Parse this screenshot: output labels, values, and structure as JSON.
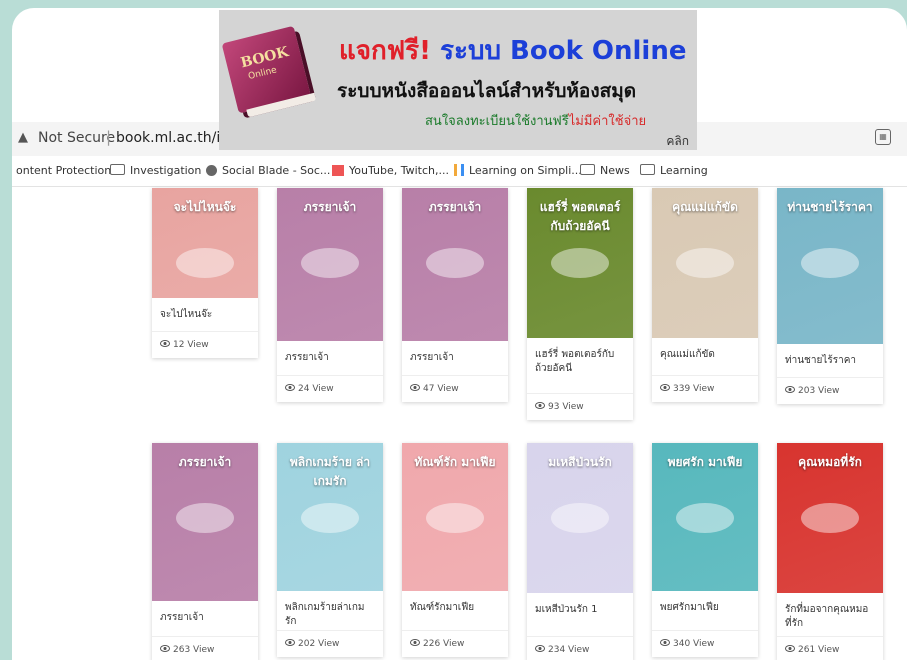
{
  "banner": {
    "line1_red": "แจกฟรี!",
    "line1_blue": "ระบบ Book Online",
    "line2": "ระบบหนังสือออนไลน์สำหรับห้องสมุด",
    "line3_green": "สนใจลงทะเบียนใช้งานฟรี",
    "line3_red": "ไม่มีค่าใช้จ่าย",
    "click": "คลิก",
    "book_title": "BOOK",
    "book_subtitle": "Online"
  },
  "browser": {
    "warning": "Not Secure",
    "url": "book.ml.ac.th/index"
  },
  "bookmarks": [
    "ontent Protection",
    "Investigation",
    "Social Blade - Soc...",
    "YouTube, Twitch,...",
    "Learning on Simpli...",
    "News",
    "Learning"
  ],
  "books": [
    {
      "title": "จะไปไหนจ๊ะ",
      "views": "12 View",
      "cover": "จะไปไหนจ๊ะ",
      "color": "#e8a4a0"
    },
    {
      "title": "ภรรยาเจ้า",
      "views": "24 View",
      "cover": "ภรรยาเจ้า",
      "color": "#b87fa8"
    },
    {
      "title": "ภรรยาเจ้า",
      "views": "47 View",
      "cover": "ภรรยาเจ้า",
      "color": "#b87fa8"
    },
    {
      "title": "แฮร์รี่ พอตเตอร์กับถ้วยอัคนี",
      "views": "93 View",
      "cover": "แฮร์รี่ พอตเตอร์กับถ้วยอัคนี",
      "color": "#6a8a2e"
    },
    {
      "title": "คุณแม่แก้ขัด",
      "views": "339 View",
      "cover": "คุณแม่แก้ขัด",
      "color": "#d9c9b4"
    },
    {
      "title": "ท่านชายไร้ราคา",
      "views": "203 View",
      "cover": "ท่านชายไร้ราคา",
      "color": "#79b6c8"
    },
    {
      "title": "ภรรยาเจ้า",
      "views": "263 View",
      "cover": "ภรรยาเจ้า",
      "color": "#b87fa8"
    },
    {
      "title": "พลิกเกมร้ายล่าเกมรัก",
      "views": "202 View",
      "cover": "พลิกเกมร้าย ล่าเกมรัก",
      "color": "#9fd3df"
    },
    {
      "title": "ทัณฑ์รักมาเฟีย",
      "views": "226 View",
      "cover": "ทัณฑ์รัก มาเฟีย",
      "color": "#f0a8ac"
    },
    {
      "title": "มเหสีป่วนรัก 1",
      "views": "234 View",
      "cover": "มเหสีป่วนรัก",
      "color": "#d8d4ec"
    },
    {
      "title": "พยศรักมาเฟีย",
      "views": "340 View",
      "cover": "พยศรัก มาเฟีย",
      "color": "#57b8bd"
    },
    {
      "title": "รักที่มอจากคุณหมอที่รัก",
      "views": "261 View",
      "cover": "คุณหมอที่รัก",
      "color": "#d8342f"
    }
  ]
}
